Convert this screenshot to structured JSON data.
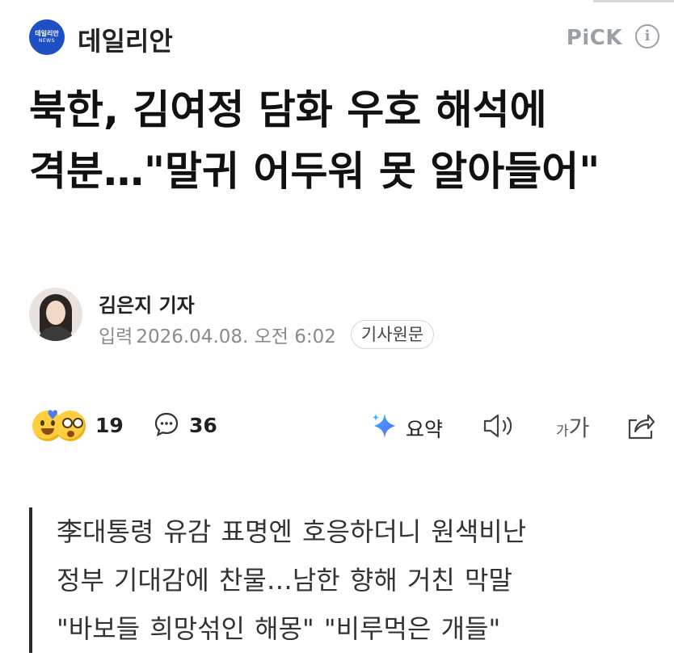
{
  "header": {
    "logo_line1": "데일리안",
    "logo_line2": "NEWS",
    "press_name": "데일리안",
    "pick_label": "PiCK",
    "info_icon": "i"
  },
  "article": {
    "headline": "북한, 김여정 담화 우호 해석에 격분…\"말귀 어두워 못 알아들어\"",
    "reporter": "김은지 기자",
    "date_label": "입력",
    "date_value": "2026.04.08. 오전 6:02",
    "original_button": "기사원문",
    "subhead": [
      "李대통령 유감 표명엔 호응하더니 원색비난",
      "정부 기대감에 찬물…남한 향해 거친 막말",
      "\"바보들 희망섞인 해몽\" \"비루먹은 개들\""
    ]
  },
  "actions": {
    "reaction_count": "19",
    "comment_count": "36",
    "summary_label": "요약",
    "font_small": "가",
    "font_large": "가"
  },
  "colors": {
    "logo_blue": "#1f4fc4",
    "pick_gray": "#9aa0a6",
    "summary_icon_start": "#6a5cff",
    "summary_icon_end": "#2fb6ff"
  },
  "icons": [
    "press-logo-icon",
    "info-icon",
    "reaction-emoji-icon",
    "comment-bubble-icon",
    "ai-summary-sparkle-icon",
    "speaker-icon",
    "font-size-icon",
    "share-icon"
  ]
}
